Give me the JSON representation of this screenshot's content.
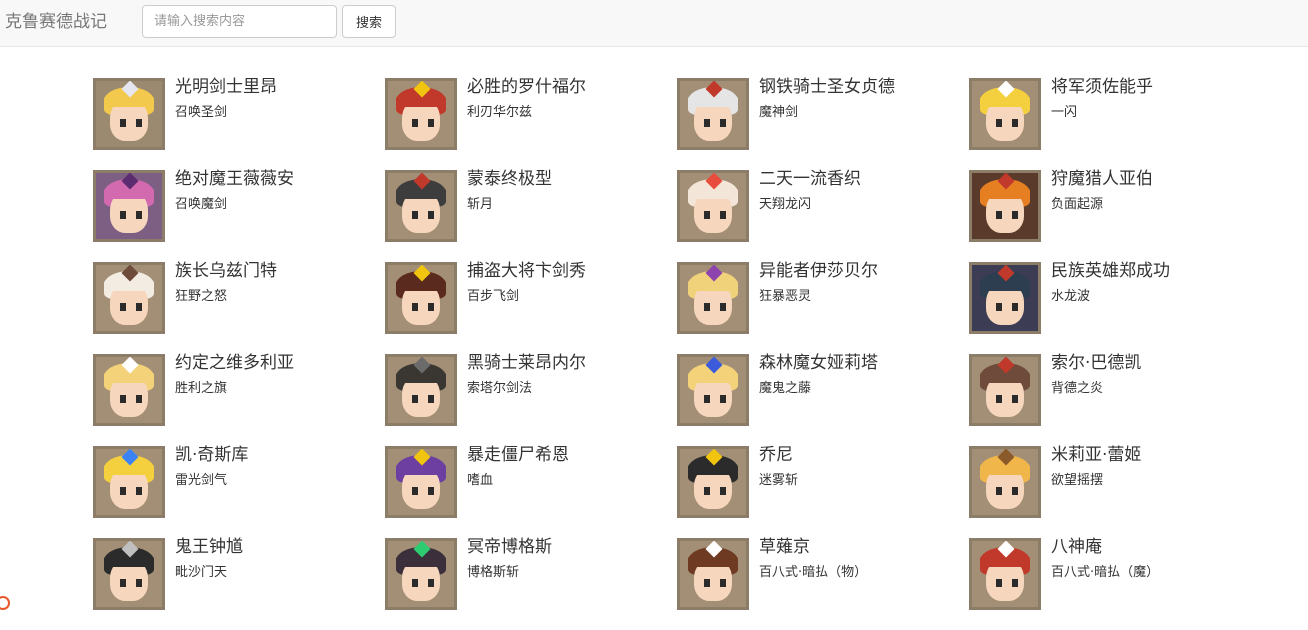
{
  "header": {
    "brand": "克鲁赛德战记",
    "search_placeholder": "请输入搜索内容",
    "search_value": "",
    "search_button": "搜索"
  },
  "heroes": [
    {
      "name": "光明剑士里昂",
      "skill": "召唤圣剑",
      "colors": {
        "bg": "#9c8a70",
        "hair": "#f2c94c",
        "acc": "#e6e6f0"
      }
    },
    {
      "name": "必胜的罗什福尔",
      "skill": "利刃华尔兹",
      "colors": {
        "bg": "#a38f76",
        "hair": "#c0392b",
        "acc": "#f1c40f"
      }
    },
    {
      "name": "钢铁骑士圣女贞德",
      "skill": "魔神剑",
      "colors": {
        "bg": "#a38f76",
        "hair": "#e5e5e5",
        "acc": "#c0392b"
      }
    },
    {
      "name": "将军须佐能乎",
      "skill": "一闪",
      "colors": {
        "bg": "#a38f76",
        "hair": "#f4d03f",
        "acc": "#ffffff"
      }
    },
    {
      "name": "绝对魔王薇薇安",
      "skill": "召唤魔剑",
      "colors": {
        "bg": "#7e5f84",
        "hair": "#d36ab0",
        "acc": "#5b2c6f"
      }
    },
    {
      "name": "蒙泰终极型",
      "skill": "斩月",
      "colors": {
        "bg": "#a38f76",
        "hair": "#3d3d3d",
        "acc": "#c0392b"
      }
    },
    {
      "name": "二天一流香织",
      "skill": "天翔龙闪",
      "colors": {
        "bg": "#a38f76",
        "hair": "#f3e6d8",
        "acc": "#e74c3c"
      }
    },
    {
      "name": "狩魔猎人亚伯",
      "skill": "负面起源",
      "colors": {
        "bg": "#5a3a2a",
        "hair": "#e67e22",
        "acc": "#c0392b"
      }
    },
    {
      "name": "族长乌兹门特",
      "skill": "狂野之怒",
      "colors": {
        "bg": "#a38f76",
        "hair": "#f3ece2",
        "acc": "#6e4b3a"
      }
    },
    {
      "name": "捕盗大将卞剑秀",
      "skill": "百步飞剑",
      "colors": {
        "bg": "#a38f76",
        "hair": "#5b2a1e",
        "acc": "#f1c40f"
      }
    },
    {
      "name": "异能者伊莎贝尔",
      "skill": "狂暴恶灵",
      "colors": {
        "bg": "#a38f76",
        "hair": "#f0d27a",
        "acc": "#8e44ad"
      }
    },
    {
      "name": "民族英雄郑成功",
      "skill": "水龙波",
      "colors": {
        "bg": "#3c3c55",
        "hair": "#2c3e50",
        "acc": "#c0392b"
      }
    },
    {
      "name": "约定之维多利亚",
      "skill": "胜利之旗",
      "colors": {
        "bg": "#a38f76",
        "hair": "#f4d27a",
        "acc": "#ffffff"
      }
    },
    {
      "name": "黑骑士莱昂内尔",
      "skill": "索塔尔剑法",
      "colors": {
        "bg": "#a38f76",
        "hair": "#3a3632",
        "acc": "#6b6b6b"
      }
    },
    {
      "name": "森林魔女娅莉塔",
      "skill": "魔鬼之藤",
      "colors": {
        "bg": "#a38f76",
        "hair": "#f4d27a",
        "acc": "#3b5bdb"
      }
    },
    {
      "name": "索尔·巴德凯",
      "skill": "背德之炎",
      "colors": {
        "bg": "#a38f76",
        "hair": "#6e4b3a",
        "acc": "#c0392b"
      }
    },
    {
      "name": "凯·奇斯库",
      "skill": "雷光剑气",
      "colors": {
        "bg": "#a38f76",
        "hair": "#f4d03f",
        "acc": "#3b82f6"
      }
    },
    {
      "name": "暴走僵尸希恩",
      "skill": "嗜血",
      "colors": {
        "bg": "#a38f76",
        "hair": "#6c3fa0",
        "acc": "#f1c40f"
      }
    },
    {
      "name": "乔尼",
      "skill": "迷雾斩",
      "colors": {
        "bg": "#a38f76",
        "hair": "#2b2b2b",
        "acc": "#f1c40f"
      }
    },
    {
      "name": "米莉亚·蕾姬",
      "skill": "欲望摇摆",
      "colors": {
        "bg": "#a38f76",
        "hair": "#f0b64a",
        "acc": "#8b5a2b"
      }
    },
    {
      "name": "鬼王钟馗",
      "skill": "毗沙门天",
      "colors": {
        "bg": "#a38f76",
        "hair": "#2b2b2b",
        "acc": "#c0c0c0"
      }
    },
    {
      "name": "冥帝博格斯",
      "skill": "博格斯斩",
      "colors": {
        "bg": "#a38f76",
        "hair": "#3a2f3a",
        "acc": "#2ecc71"
      }
    },
    {
      "name": "草薙京",
      "skill": "百八式·暗払（物）",
      "colors": {
        "bg": "#a38f76",
        "hair": "#6e3b22",
        "acc": "#ffffff"
      }
    },
    {
      "name": "八神庵",
      "skill": "百八式·暗払（魔）",
      "colors": {
        "bg": "#a38f76",
        "hair": "#c0392b",
        "acc": "#ffffff"
      }
    }
  ]
}
